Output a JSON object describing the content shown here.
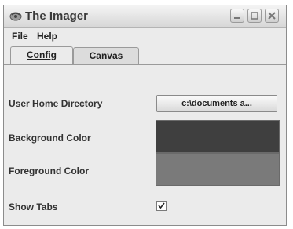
{
  "window": {
    "title": "The Imager",
    "icon": "app-icon",
    "controls": [
      "minimize-icon",
      "maximize-icon",
      "close-icon"
    ]
  },
  "menubar": {
    "items": [
      {
        "label": "File"
      },
      {
        "label": "Help"
      }
    ]
  },
  "tabs": [
    {
      "label": "Config",
      "selected": true
    },
    {
      "label": "Canvas",
      "selected": false
    }
  ],
  "config": {
    "user_home_label": "User Home Directory",
    "user_home_value": "c:\\documents a...",
    "background_label": "Background Color",
    "background_color": "#3f3f3f",
    "foreground_label": "Foreground Color",
    "foreground_color": "#7a7a7a",
    "show_tabs_label": "Show Tabs",
    "show_tabs_checked": true
  }
}
